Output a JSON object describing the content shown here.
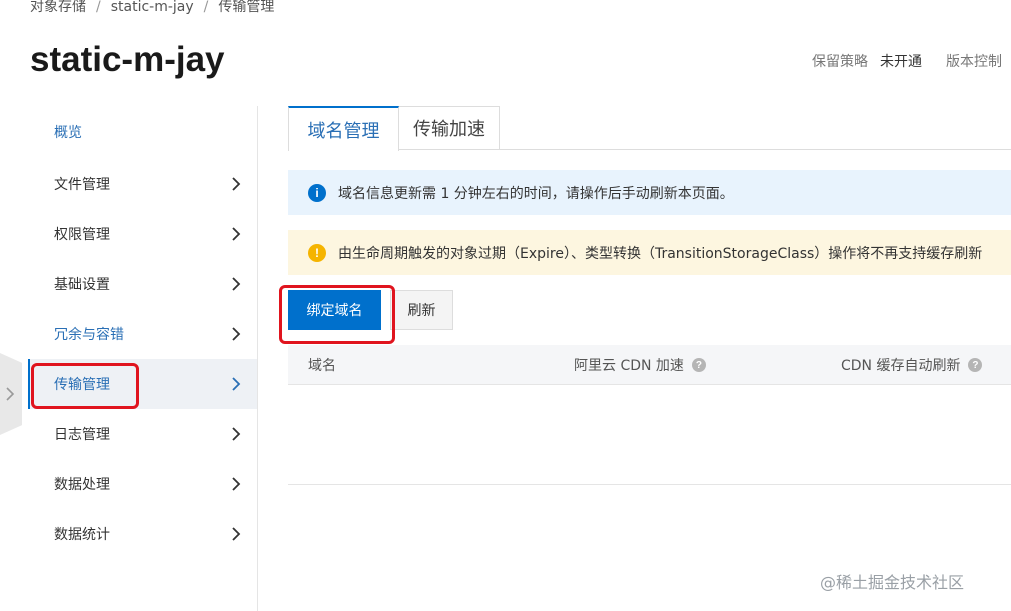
{
  "breadcrumb": [
    "对象存储",
    "static-m-jay",
    "传输管理"
  ],
  "title": "static-m-jay",
  "header_meta": {
    "retention_label": "保留策略",
    "retention_value": "未开通",
    "version_label": "版本控制"
  },
  "sidebar": {
    "items": [
      {
        "label": "概览"
      },
      {
        "label": "文件管理"
      },
      {
        "label": "权限管理"
      },
      {
        "label": "基础设置"
      },
      {
        "label": "冗余与容错"
      },
      {
        "label": "传输管理"
      },
      {
        "label": "日志管理"
      },
      {
        "label": "数据处理"
      },
      {
        "label": "数据统计"
      }
    ]
  },
  "tabs": [
    "域名管理",
    "传输加速"
  ],
  "info_message": "域名信息更新需 1 分钟左右的时间，请操作后手动刷新本页面。",
  "warning_message": "由生命周期触发的对象过期（Expire）、类型转换（TransitionStorageClass）操作将不再支持缓存刷新",
  "buttons": {
    "bind_domain": "绑定域名",
    "refresh": "刷新"
  },
  "table": {
    "columns": [
      "域名",
      "阿里云 CDN 加速",
      "CDN 缓存自动刷新"
    ]
  },
  "watermark": "@稀土掘金技术社区",
  "colors": {
    "accent": "#0070cc",
    "highlight": "#e0141e",
    "info_bg": "#e8f3fd",
    "warning_bg": "#fdf6e0"
  }
}
